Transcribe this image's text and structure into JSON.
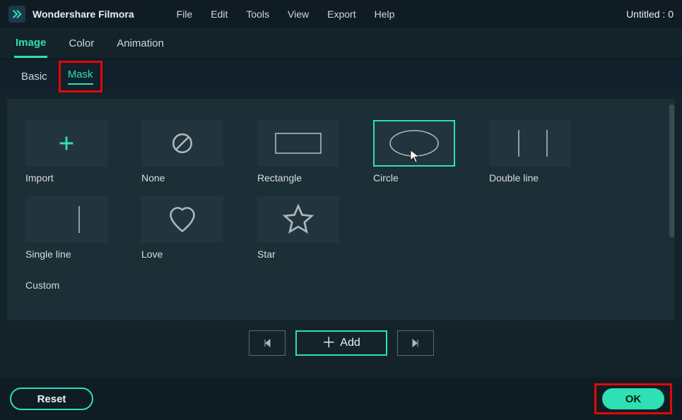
{
  "app": {
    "name": "Wondershare Filmora",
    "document": "Untitled : 0"
  },
  "menubar": [
    "File",
    "Edit",
    "Tools",
    "View",
    "Export",
    "Help"
  ],
  "main_tabs": {
    "items": [
      "Image",
      "Color",
      "Animation"
    ],
    "active": "Image"
  },
  "sub_tabs": {
    "items": [
      "Basic",
      "Mask"
    ],
    "active": "Mask"
  },
  "masks": {
    "items": [
      {
        "id": "import",
        "label": "Import"
      },
      {
        "id": "none",
        "label": "None"
      },
      {
        "id": "rectangle",
        "label": "Rectangle"
      },
      {
        "id": "circle",
        "label": "Circle",
        "selected": true
      },
      {
        "id": "double-line",
        "label": "Double line"
      },
      {
        "id": "single-line",
        "label": "Single line"
      },
      {
        "id": "love",
        "label": "Love"
      },
      {
        "id": "star",
        "label": "Star"
      }
    ],
    "custom_label": "Custom"
  },
  "keyframe": {
    "add_label": "Add"
  },
  "footer": {
    "reset": "Reset",
    "ok": "OK"
  }
}
